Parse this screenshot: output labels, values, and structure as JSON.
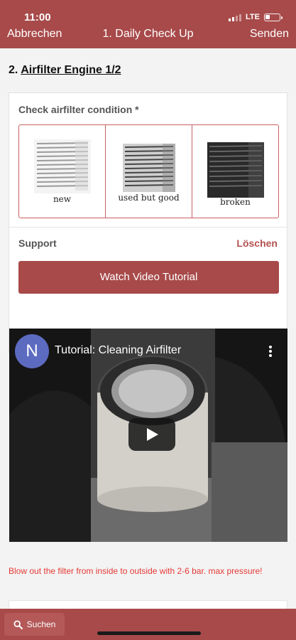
{
  "status": {
    "time": "11:00",
    "network": "LTE",
    "battery_icon": "battery-low-icon",
    "signal_icon": "cellular-signal-icon"
  },
  "nav": {
    "cancel_label": "Abbrechen",
    "title": "1. Daily Check Up",
    "send_label": "Senden"
  },
  "section": {
    "number": "2.",
    "title": "Airfilter Engine 1/2"
  },
  "condition": {
    "label": "Check airfilter condition *",
    "options": [
      {
        "caption": "new",
        "icon": "airfilter-new-image"
      },
      {
        "caption": "used but good",
        "icon": "airfilter-used-image"
      },
      {
        "caption": "broken",
        "icon": "airfilter-broken-image"
      }
    ]
  },
  "support": {
    "label": "Support",
    "clear_label": "Löschen",
    "video_button_label": "Watch Video Tutorial"
  },
  "video": {
    "channel_initial": "N",
    "title": "Tutorial: Cleaning Airfilter",
    "menu_icon": "more-vertical-icon",
    "play_icon": "play-icon"
  },
  "hint": "Blow out the filter from inside to outside with 2-6 bar. max pressure!",
  "bottom": {
    "search_label": "Suchen",
    "search_icon": "search-icon"
  },
  "colors": {
    "brand": "#a84a4a",
    "accent_border": "#c86060",
    "warning_text": "#e53935",
    "channel_avatar": "#5c6bc0"
  }
}
